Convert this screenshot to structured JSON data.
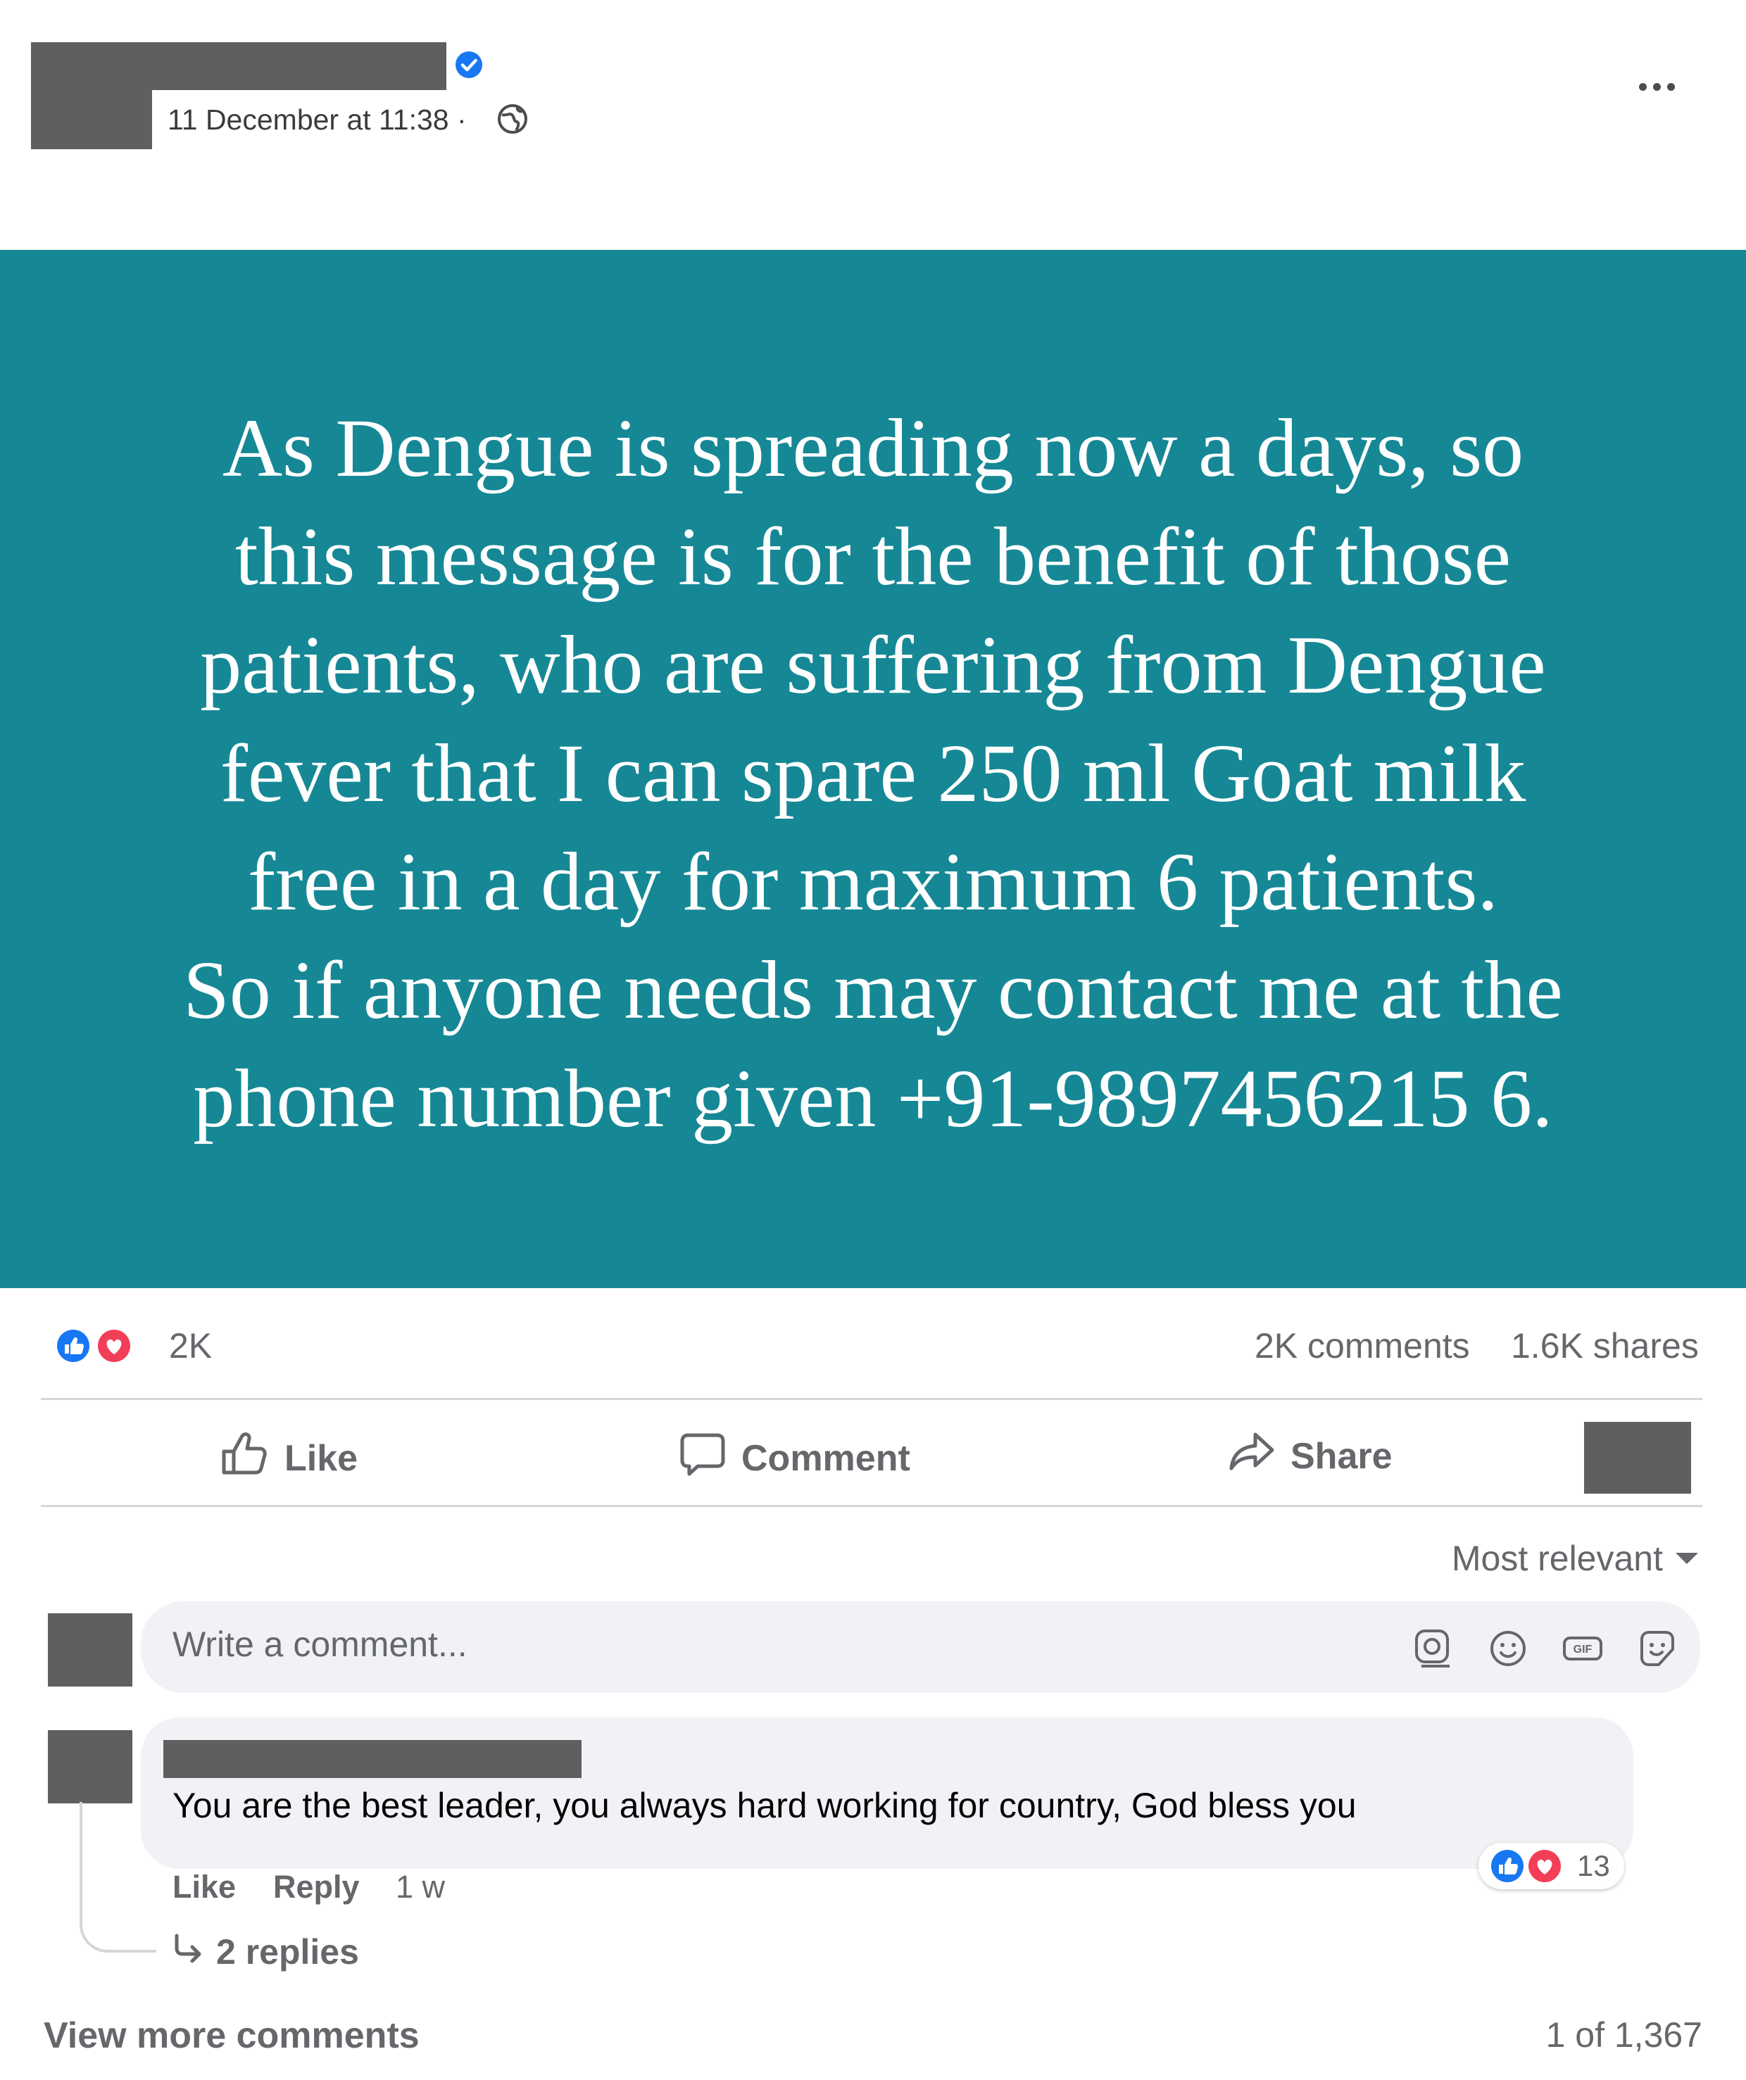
{
  "post": {
    "timestamp": "11 December at 11:38 ·",
    "audience_icon": "globe-icon",
    "verified_icon": "verified-badge-icon",
    "message": "As Dengue is spreading now a days, so\nthis message is for the benefit of those\npatients, who are suffering from Dengue\nfever that I can spare 250 ml Goat  milk\nfree in a day for maximum 6 patients.\nSo if anyone needs may contact me at the\nphone number given +91-9897456215 6.",
    "background_color": "#168895"
  },
  "stats": {
    "reactions_count": "2K",
    "comments": "2K comments",
    "shares": "1.6K shares"
  },
  "actions": {
    "like": "Like",
    "comment": "Comment",
    "share": "Share"
  },
  "sort": {
    "label": "Most relevant"
  },
  "composer": {
    "placeholder": "Write a comment..."
  },
  "comment": {
    "text": "You are the best leader, you always hard working for country, God bless you",
    "reaction_count": "13",
    "like": "Like",
    "reply": "Reply",
    "time": "1 w",
    "replies": "2 replies"
  },
  "footer": {
    "view_more": "View more comments",
    "pagination": "1 of 1,367"
  },
  "colors": {
    "accent_blue": "#1877f2",
    "love_red": "#f33e58",
    "text_secondary": "#65676b"
  }
}
